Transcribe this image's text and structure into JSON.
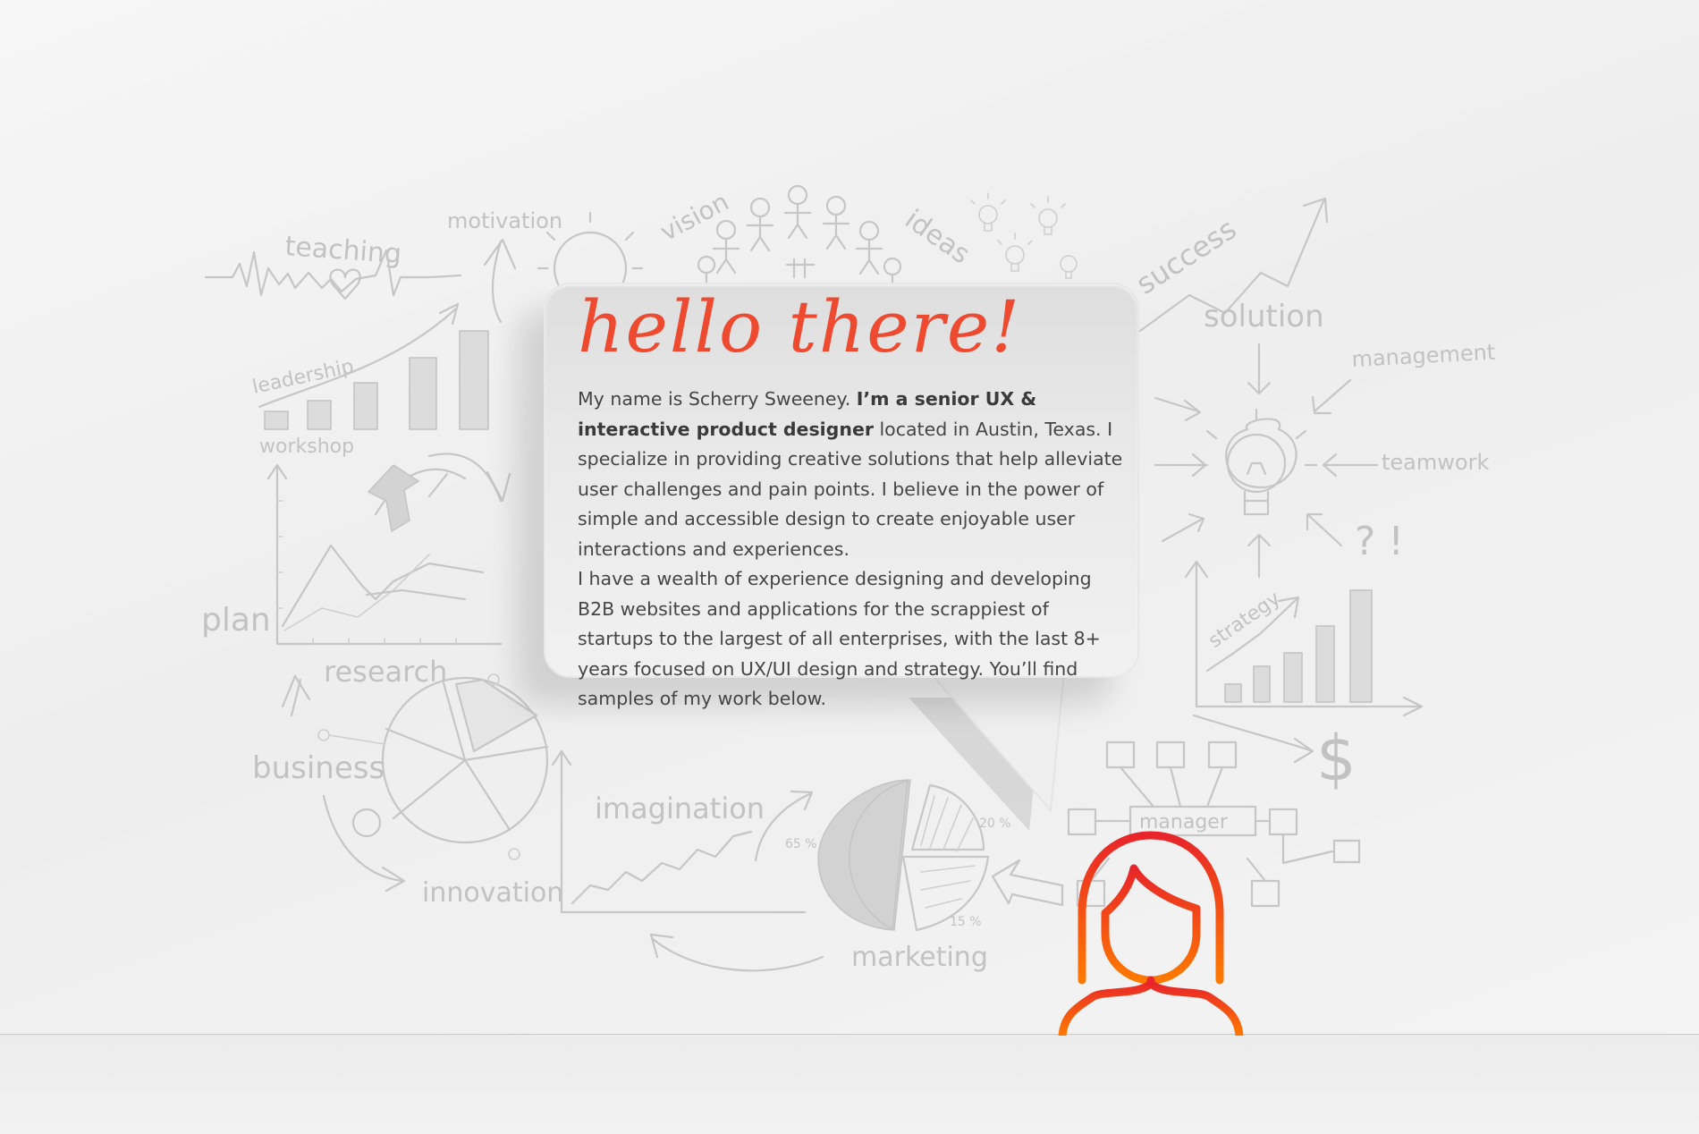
{
  "hero": {
    "greeting": "hello there!",
    "bio": {
      "intro": "My name is Scherry Sweeney. ",
      "highlight": "I’m a senior UX & interactive product designer",
      "rest": " located in Austin, Texas. I specialize in providing creative solutions that help alleviate user challenges and pain points. I believe in the power of simple and accessible design to create enjoyable user interactions and experiences.",
      "paragraph2": "I have a wealth of experience designing and developing B2B websites and applications for the scrappiest of startups to the largest of all enterprises, with the last 8+ years focused on UX/UI design and strategy. You’ll find samples of my work below."
    }
  },
  "background_words": {
    "teaching": "teaching",
    "motivation": "motivation",
    "vision": "vision",
    "ideas": "ideas",
    "success": "success",
    "solution": "solution",
    "management": "management",
    "teamwork": "teamwork",
    "leadership": "leadership",
    "workshop": "workshop",
    "plan": "plan",
    "research": "research",
    "business": "business",
    "innovation": "innovation",
    "imagination": "imagination",
    "marketing": "marketing",
    "strategy": "strategy",
    "manager": "manager",
    "pct_65": "65 %",
    "pct_20": "20 %",
    "pct_15": "15 %",
    "question": "? !",
    "dollar": "$"
  },
  "icons": {
    "avatar": "woman-profile-icon",
    "accent_gradient_top": "#e8252a",
    "accent_gradient_bottom": "#ff7a00"
  },
  "colors": {
    "greeting": "#ee4a30",
    "text": "#454545",
    "sketch": "#c6c6c6"
  }
}
